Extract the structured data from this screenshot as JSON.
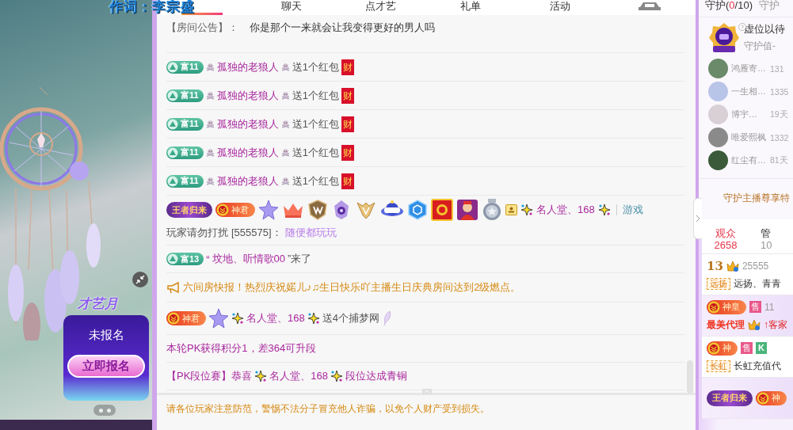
{
  "video": {
    "lyric": "作词：李宗盛",
    "event_logo": "才艺月",
    "event_status": "未报名",
    "event_button": "立即报名"
  },
  "chat": {
    "tabs": [
      {
        "kind": "unlabeled",
        "selected": true
      },
      {
        "kind": "text",
        "label": "聊天",
        "selected": false
      },
      {
        "kind": "text",
        "label": "点才艺",
        "selected": false
      },
      {
        "kind": "text",
        "label": "礼单",
        "selected": false
      },
      {
        "kind": "text",
        "label": "活动",
        "selected": false
      },
      {
        "kind": "car",
        "selected": false
      }
    ],
    "announcement": {
      "label": "【房间公告】：",
      "text": "你是那个一来就会让我变得更好的男人吗"
    },
    "messages": [
      {
        "kind": "gift",
        "badge": "富11",
        "name": "孤独的老狼人",
        "action": "送1个红包",
        "packet": "财"
      },
      {
        "kind": "gift",
        "badge": "富11",
        "name": "孤独的老狼人",
        "action": "送1个红包",
        "packet": "财"
      },
      {
        "kind": "gift",
        "badge": "富11",
        "name": "孤独的老狼人",
        "action": "送1个红包",
        "packet": "财"
      },
      {
        "kind": "gift",
        "badge": "富11",
        "name": "孤独的老狼人",
        "action": "送1个红包",
        "packet": "财"
      },
      {
        "kind": "gift",
        "badge": "富11",
        "name": "孤独的老狼人",
        "action": "送1个红包",
        "packet": "财"
      },
      {
        "kind": "vip",
        "title": "王者归来",
        "rank": "神君",
        "name": "名人堂、168",
        "tag": "游戏",
        "prefix": "玩家请勿打扰",
        "id": "[555575]：",
        "text": "随便都玩玩"
      },
      {
        "kind": "enter",
        "badge": "富13",
        "open": "“",
        "name": "坟地、听情歌00",
        "suffix": "”来了"
      },
      {
        "kind": "broadcast",
        "text": "六间房快报！热烈庆祝婼儿♪♫生日快乐吖主播生日庆典房间达到2级燃点。"
      },
      {
        "kind": "vipgift",
        "rank": "神君",
        "name": "名人堂、168",
        "action": "送4个捕梦网"
      },
      {
        "kind": "system",
        "text": "本轮PK获得积分1，差364可升段"
      },
      {
        "kind": "pk",
        "prefix": "【PK段位赛】恭喜",
        "name": "名人堂、168",
        "suffix": "段位达成青铜"
      }
    ],
    "footer": "请各位玩家注意防范，警惕不法分子冒充他人诈骗，以免个人财产受到损失。"
  },
  "guard": {
    "tabs": [
      {
        "label": "守护(",
        "count": "0",
        "suffix": "/10)",
        "selected": true
      },
      {
        "label": "守护",
        "selected": false
      }
    ],
    "top": {
      "name": "虚位以待",
      "value": "守护值-"
    },
    "members": [
      {
        "name": "鸿雁寄…",
        "days": "131"
      },
      {
        "name": "一生相…",
        "days": "1335"
      },
      {
        "name": "博宇…",
        "days": "19天"
      },
      {
        "name": "唯爱熙枫",
        "days": "1332"
      },
      {
        "name": "红尘有…",
        "days": "81天"
      }
    ],
    "privilege": "守护主播尊享特"
  },
  "audience": {
    "tabs": [
      {
        "label": "观众",
        "count": "2658",
        "selected": true
      },
      {
        "label": "管",
        "count": "10",
        "selected": false
      }
    ],
    "users": [
      {
        "kind": "level",
        "level": "13",
        "id": "25555",
        "tag": "远扬",
        "text": "远扬、青青"
      },
      {
        "kind": "agent",
        "rank": "神皇",
        "role": "售",
        "id": "11",
        "title": "最美代理",
        "text": "↑客家"
      },
      {
        "kind": "agent2",
        "rank": "神",
        "role": "售",
        "extra": "K",
        "tag": "长虹",
        "text": "长虹充值代"
      },
      {
        "kind": "titled",
        "title": "王者归来",
        "rank": "神"
      }
    ]
  }
}
